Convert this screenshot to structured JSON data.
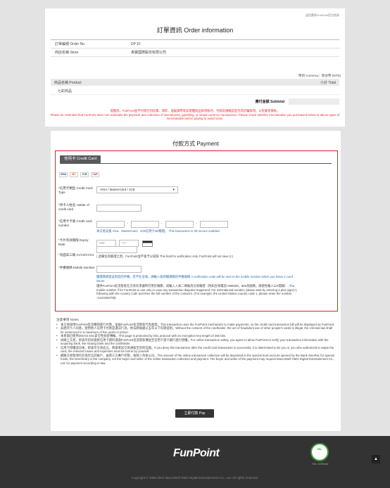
{
  "top_link": "返回賣家FunPoint官方首頁",
  "order": {
    "title": "訂單資訊 Order information",
    "order_no_label": "訂單編號 Order No.",
    "order_no_value": "DP                      1F",
    "store_label": "商店名稱 Store",
    "store_value": "貴寶國際股份有限公司",
    "currency": "幣別 Currency：新台幣 (NTD)",
    "product_header": "商品名稱 Product",
    "total_header": "小計 Total",
    "product_value": "七彩商品",
    "subtotal_label": "應付金額 Subtotal",
    "subtotal_value": "",
    "warning_zh": "提醒您，FunPoint並不代理任何投資、博弈、虛擬貨幣等非實體商品款項收付，付款前請確認是否為詐騙款項，以免蒙受損失。",
    "warning_en": "Please be reminded that FunPoint does not undertake the payment and collection of investments, gambling, or virtual currency transactions. Please check whether merchandise you purchased below to above types of merchandise before paying to avoid scam."
  },
  "payment": {
    "title": "付款方式 Payment",
    "tab_label": "信用卡 Credit Card",
    "card_logos": [
      "VISA",
      "MC",
      "JCB",
      "CUP"
    ],
    "card_type_label": "信用卡類型 Credit Card Type",
    "card_type_value": "VISA / MasterCard / JCB",
    "holder_label": "持卡人姓名 Holder of credit card",
    "card_number_label": "信用卡卡號 Credit card number",
    "card_number_hint": "本交易支援 Visa、MasterCard、JCB信用卡3D驗證。 This transaction is 3D secure enabled.",
    "expiry_label": "卡片有效期限 Expiry Date",
    "expiry_mm": "MM",
    "expiry_yy": "YY",
    "cvv_label": "背面末三碼 CVV2/CVC2",
    "cvv_hint": "( 此欄位為驗證之用，FunPoint並不會予以紀錄 This field for verification only. FunPoint will not save it.)",
    "mobile_label": "手機號碼 Mobile Number",
    "mobile_hint_blue": "驗證碼將發送到您的手機，若不在台灣，請輸入收到驗證碼的手機號碼 A verification code will be sent to the mobile number which you leave in card issuer.",
    "mobile_hint": "僅供FunPoint金流管家在交易有爭議時可用於聯繫，或輸入入後二碼做為交易驗證（例如台灣電話+886928，886為國碼，請避免輸入以0開頭）. The mobile number if for FunPoint to use only in case any transaction disputes happened. For international number, please start by entering a plus sign(+), following with the country code and then the full number of the contact's. (For example, the United States country code 1, please enter the number +1123456789)."
  },
  "notes": {
    "title": "注意事項 Notes",
    "items": [
      "本交易採用FunPoint金流機制進行付款，並由FunPoint金流管家代為收款。This transaction uses the FunPoint mechanism to make payments, so the credit card transaction bill will be displayed as FunPoint.",
      "非經持卡人同意，使用他人信用卡付款是違法行為，依法將被處以五年以下有期徒刑。Without the consent of the cardholder, the act of fraudulent use of other people's cards is illegal, the criminal law shall be sentenced to a maximum of five years in prison.",
      "本頁面已使用256-bit SSL安全性加密傳輸。This page is protected by SSL protocol with an encryption key length of 256 bits.",
      "如線上交易，即表示您同意將信用卡資料透過FunPoint金流管家傳送至信用卡發卡銀行進行授權。For online transaction safety, you agree to allow FunPoint to verify your transaction information with the acquiring bank, the issuing bank and the cardholder.",
      "信用卡授權成功後，即表示交易成立，將會寄送交易通知至您的信箱。If you deny this transaction after the credit card transaction is successful, it is determined to be you or you who authorized to swipe the card, the relevant losses and expenses must be borne by yourself.",
      "網路交易款項均存放於信託帳戶，由第三方專戶控管，收款人為本公司。The amount of the online transaction collection will be deposited in the special trust account opened by the Bank SinoPac for special funds, the beneficiary is the company, not the buyer and seller of the online transaction collection and payment. The buyer and seller of the payment may request MacroWell OMG Digital Entertainment Co., Ltd. for payment according to law."
    ]
  },
  "submit_label": "立即付款 Pay",
  "footer": {
    "logo": "FunPoint",
    "ssl_badge": "SSL",
    "ssl_text": "SSL Certificate",
    "copyright": "Copyright © 1996-2024 MacroWell OMG Digital Entertainment Co., Ltd. All rights reserved."
  },
  "colors": {
    "accent_red": "#d4232b",
    "footer_bg": "#333333"
  }
}
